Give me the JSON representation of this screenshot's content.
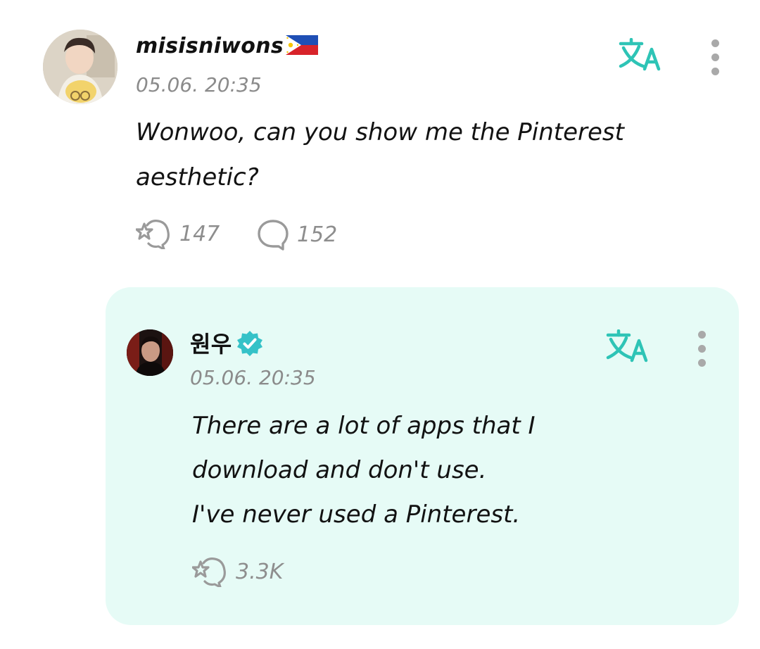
{
  "post": {
    "username": "misisniwons",
    "timestamp": "05.06. 20:35",
    "body": "Wonwoo, can you show me the Pinterest\naesthetic?",
    "likes": "147",
    "comments": "152",
    "icons": [
      "avatar",
      "philippines-flag-icon",
      "translate-icon",
      "more-options-icon",
      "like-icon",
      "comment-icon"
    ]
  },
  "reply": {
    "username": "원우",
    "verified": true,
    "timestamp": "05.06. 20:35",
    "body": "There are a lot of apps that I\ndownload and don't use.\nI've never used a Pinterest.",
    "likes": "3.3K",
    "icons": [
      "avatar",
      "verified-badge-icon",
      "translate-icon",
      "more-options-icon",
      "like-icon"
    ]
  },
  "colors": {
    "accent": "#2ec4b6",
    "reply_background": "#e6fbf6",
    "muted_text": "#8b8b8b",
    "icon_gray": "#a9a9a9",
    "verified": "#35c2c8"
  }
}
